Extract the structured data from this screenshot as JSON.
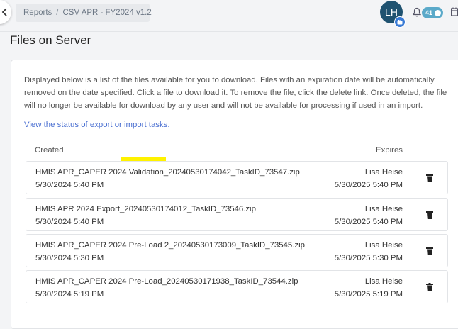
{
  "breadcrumb": {
    "root": "Reports",
    "separator": "/",
    "current": "CSV APR - FY2024 v1.2"
  },
  "user": {
    "initials": "LH"
  },
  "notifications": {
    "count": "41"
  },
  "page": {
    "title": "Files on Server",
    "description": "Displayed below is a list of the files available for you to download. Files with an expiration date will be automatically removed on the date specified. Click a file to download it. To remove the file, click the delete link. Once deleted, the file will no longer be available for download by any user and will not be available for processing if used in an import.",
    "status_link": "View the status of export or import tasks."
  },
  "table": {
    "col_created": "Created",
    "col_expires": "Expires",
    "rows": [
      {
        "name_pre": "HMIS APR_CAPER 2024 ",
        "name_hl": "Validation",
        "name_post": "_20240530174042_TaskID_73547.zip",
        "created": "5/30/2024 5:40 PM",
        "user": "Lisa Heise",
        "expires": "5/30/2025 5:40 PM"
      },
      {
        "name": "HMIS APR 2024 Export_20240530174012_TaskID_73546.zip",
        "created": "5/30/2024 5:40 PM",
        "user": "Lisa Heise",
        "expires": "5/30/2025 5:40 PM"
      },
      {
        "name": "HMIS APR_CAPER 2024 Pre-Load 2_20240530173009_TaskID_73545.zip",
        "created": "5/30/2024 5:30 PM",
        "user": "Lisa Heise",
        "expires": "5/30/2025 5:30 PM"
      },
      {
        "name": "HMIS APR_CAPER 2024 Pre-Load_20240530171938_TaskID_73544.zip",
        "created": "5/30/2024 5:19 PM",
        "user": "Lisa Heise",
        "expires": "5/30/2025 5:19 PM"
      }
    ]
  },
  "colors": {
    "accent_link": "#4a6fd1",
    "avatar": "#1f5270",
    "badge": "#5aa9c9",
    "highlight": "#fff200"
  }
}
